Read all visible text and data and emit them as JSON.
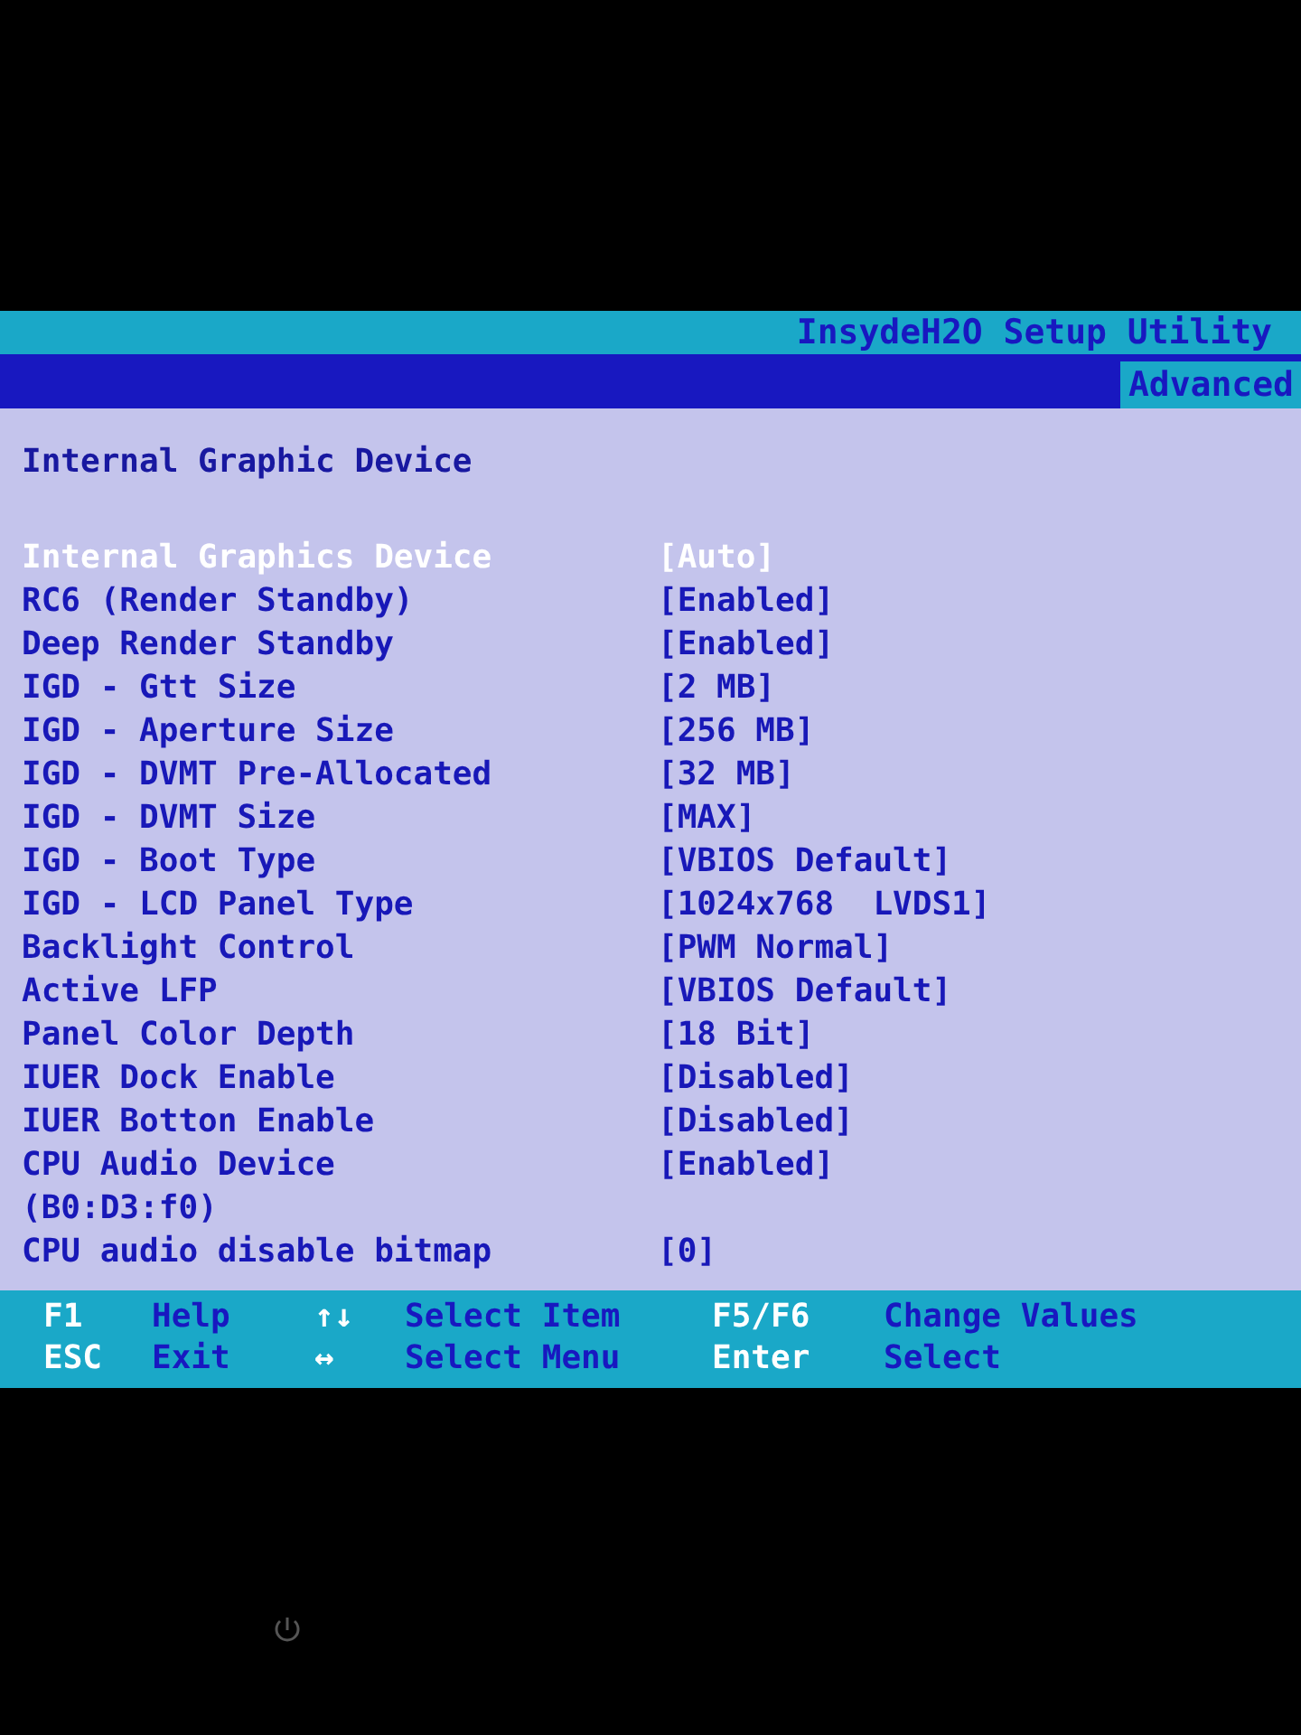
{
  "title_bar": {
    "title": "InsydeH2O Setup Utility"
  },
  "tabs": [
    {
      "label": "Advanced",
      "selected": true
    }
  ],
  "section": {
    "title": "Internal Graphic Device"
  },
  "settings": [
    {
      "name": "Internal Graphics Device",
      "value": "[Auto]",
      "selected": true
    },
    {
      "name": "RC6 (Render Standby)",
      "value": "[Enabled]",
      "selected": false
    },
    {
      "name": "Deep Render Standby",
      "value": "[Enabled]",
      "selected": false
    },
    {
      "name": "IGD - Gtt Size",
      "value": "[2 MB]",
      "selected": false
    },
    {
      "name": "IGD - Aperture Size",
      "value": "[256 MB]",
      "selected": false
    },
    {
      "name": "IGD - DVMT Pre-Allocated",
      "value": "[32 MB]",
      "selected": false
    },
    {
      "name": "IGD - DVMT Size",
      "value": "[MAX]",
      "selected": false
    },
    {
      "name": "IGD - Boot Type",
      "value": "[VBIOS Default]",
      "selected": false
    },
    {
      "name": "IGD - LCD Panel Type",
      "value": "[1024x768  LVDS1]",
      "selected": false
    },
    {
      "name": "Backlight Control",
      "value": "[PWM Normal]",
      "selected": false
    },
    {
      "name": "Active LFP",
      "value": "[VBIOS Default]",
      "selected": false
    },
    {
      "name": "Panel Color Depth",
      "value": "[18 Bit]",
      "selected": false
    },
    {
      "name": "IUER Dock Enable",
      "value": "[Disabled]",
      "selected": false
    },
    {
      "name": "IUER Botton Enable",
      "value": "[Disabled]",
      "selected": false
    },
    {
      "name": "CPU Audio Device",
      "name_continued": "(B0:D3:f0)",
      "value": "[Enabled]",
      "selected": false
    },
    {
      "name": "CPU audio disable bitmap",
      "value": "[0]",
      "selected": false
    }
  ],
  "help_bar": [
    {
      "key": "F1",
      "action": "Help"
    },
    {
      "key": "↑↓",
      "action": "Select Item"
    },
    {
      "key": "F5/F6",
      "action": "Change Values"
    },
    {
      "key": "ESC",
      "action": "Exit"
    },
    {
      "key": "↔",
      "action": "Select Menu"
    },
    {
      "key": "Enter",
      "action": "Select"
    }
  ]
}
